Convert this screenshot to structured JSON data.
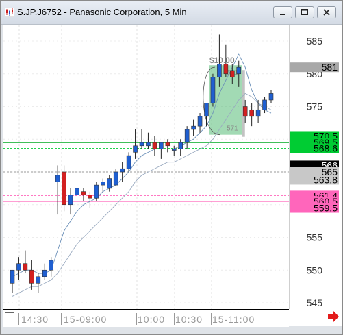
{
  "window": {
    "title": "S.JP.J6752 - Panasonic Corporation, 5 Min"
  },
  "icons": {
    "app": "chart-icon",
    "minimize": "minimize-icon",
    "maximize": "maximize-icon",
    "close": "close-icon",
    "scroll": "arrow-right-icon"
  },
  "colors": {
    "up_candle": "#1f5fd1",
    "down_candle": "#d22020",
    "green_band": "#00cc33",
    "pink_band": "#ff66bb",
    "gray_line": "#9a9a9a",
    "highlight": "#55bb77"
  },
  "time_axis": {
    "labels": [
      "14:30",
      "15-09:00",
      "10:00",
      "10:30",
      "15-11:00"
    ]
  },
  "price_axis": {
    "ticks": [
      "585",
      "580",
      "575",
      "570",
      "565",
      "560",
      "555",
      "550",
      "545"
    ],
    "tags": [
      {
        "text": "581",
        "bg": "#a8a8a8",
        "fg": "#000000"
      },
      {
        "text": "570.5",
        "bg": "#00cc33",
        "fg": "#000000"
      },
      {
        "text": "569.5",
        "bg": "#00cc33",
        "fg": "#000000"
      },
      {
        "text": "568.6",
        "bg": "#00cc33",
        "fg": "#000000"
      },
      {
        "text": "566",
        "bg": "#000000",
        "fg": "#ffffff"
      },
      {
        "text": "565",
        "bg": "#c8c8c8",
        "fg": "#000000"
      },
      {
        "text": "563.8",
        "bg": "#c8c8c8",
        "fg": "#000000"
      },
      {
        "text": "561.4",
        "bg": "#ff66bb",
        "fg": "#000000"
      },
      {
        "text": "560.5",
        "bg": "#ff66bb",
        "fg": "#000000"
      },
      {
        "text": "559.5",
        "bg": "#ff66bb",
        "fg": "#000000"
      }
    ]
  },
  "annotation": {
    "range_label": "$10.00",
    "top_value": "581",
    "bottom_value": "571"
  },
  "chart_data": {
    "type": "candlestick",
    "title": "S.JP.J6752 - Panasonic Corporation, 5 Min",
    "ylim": [
      543,
      588
    ],
    "x_labels": [
      "14:30",
      "15-09:00",
      "10:00",
      "10:30",
      "15-11:00"
    ],
    "candles": [
      {
        "o": 548,
        "h": 550,
        "l": 546.5,
        "c": 550,
        "dir": "up"
      },
      {
        "o": 550,
        "h": 552,
        "l": 548.5,
        "c": 551,
        "dir": "up"
      },
      {
        "o": 551,
        "h": 553,
        "l": 549.5,
        "c": 550,
        "dir": "down"
      },
      {
        "o": 550,
        "h": 551.5,
        "l": 547,
        "c": 548,
        "dir": "down"
      },
      {
        "o": 548,
        "h": 549.5,
        "l": 546.5,
        "c": 549,
        "dir": "up"
      },
      {
        "o": 549,
        "h": 551,
        "l": 548.5,
        "c": 550,
        "dir": "up"
      },
      {
        "o": 550,
        "h": 552,
        "l": 549,
        "c": 551.5,
        "dir": "up"
      },
      {
        "o": 564.5,
        "h": 566,
        "l": 558.5,
        "c": 563.5,
        "dir": "up"
      },
      {
        "o": 565,
        "h": 566,
        "l": 559,
        "c": 560,
        "dir": "down"
      },
      {
        "o": 560,
        "h": 562.5,
        "l": 558.5,
        "c": 561.5,
        "dir": "up"
      },
      {
        "o": 561.5,
        "h": 563,
        "l": 560.5,
        "c": 562.5,
        "dir": "up"
      },
      {
        "o": 562,
        "h": 562.5,
        "l": 560.5,
        "c": 561.5,
        "dir": "down"
      },
      {
        "o": 561.5,
        "h": 562,
        "l": 559.5,
        "c": 561,
        "dir": "down"
      },
      {
        "o": 561,
        "h": 563.5,
        "l": 560.5,
        "c": 563,
        "dir": "up"
      },
      {
        "o": 563,
        "h": 564,
        "l": 562,
        "c": 563.5,
        "dir": "up"
      },
      {
        "o": 562.5,
        "h": 564.5,
        "l": 562,
        "c": 564,
        "dir": "up"
      },
      {
        "o": 563,
        "h": 565.5,
        "l": 563,
        "c": 565,
        "dir": "up"
      },
      {
        "o": 565,
        "h": 566.5,
        "l": 563.5,
        "c": 565.5,
        "dir": "up"
      },
      {
        "o": 565.5,
        "h": 568,
        "l": 565,
        "c": 567.5,
        "dir": "up"
      },
      {
        "o": 568,
        "h": 571.5,
        "l": 567,
        "c": 569,
        "dir": "up"
      },
      {
        "o": 569,
        "h": 571.5,
        "l": 568.5,
        "c": 569.5,
        "dir": "up"
      },
      {
        "o": 569.5,
        "h": 571,
        "l": 568.5,
        "c": 569,
        "dir": "up"
      },
      {
        "o": 569.5,
        "h": 570.5,
        "l": 567.5,
        "c": 568.5,
        "dir": "down"
      },
      {
        "o": 568.5,
        "h": 569.5,
        "l": 567,
        "c": 569.5,
        "dir": "up"
      },
      {
        "o": 569.5,
        "h": 570,
        "l": 568,
        "c": 569,
        "dir": "down"
      },
      {
        "o": 568.5,
        "h": 569,
        "l": 567.5,
        "c": 568.5,
        "dir": "up"
      },
      {
        "o": 568.5,
        "h": 570,
        "l": 567.5,
        "c": 569.5,
        "dir": "up"
      },
      {
        "o": 569.5,
        "h": 572,
        "l": 568.5,
        "c": 571.5,
        "dir": "up"
      },
      {
        "o": 571.5,
        "h": 573,
        "l": 570.5,
        "c": 572,
        "dir": "up"
      },
      {
        "o": 572,
        "h": 574,
        "l": 571,
        "c": 573.5,
        "dir": "up"
      },
      {
        "o": 573.5,
        "h": 575.5,
        "l": 572,
        "c": 575.5,
        "dir": "up"
      },
      {
        "o": 575.5,
        "h": 580,
        "l": 575,
        "c": 579.5,
        "dir": "up"
      },
      {
        "o": 579.5,
        "h": 586,
        "l": 578,
        "c": 581.5,
        "dir": "up"
      },
      {
        "o": 581.5,
        "h": 584.5,
        "l": 579.5,
        "c": 580,
        "dir": "down"
      },
      {
        "o": 580.5,
        "h": 581.5,
        "l": 578.5,
        "c": 579.5,
        "dir": "down"
      },
      {
        "o": 580,
        "h": 582,
        "l": 578,
        "c": 581,
        "dir": "up"
      },
      {
        "o": 575,
        "h": 576,
        "l": 572.5,
        "c": 573.5,
        "dir": "down"
      },
      {
        "o": 574.5,
        "h": 575.5,
        "l": 572,
        "c": 573.5,
        "dir": "down"
      },
      {
        "o": 573.5,
        "h": 576,
        "l": 572.5,
        "c": 574.5,
        "dir": "up"
      },
      {
        "o": 574.5,
        "h": 576.5,
        "l": 574,
        "c": 576,
        "dir": "up"
      },
      {
        "o": 576,
        "h": 577.5,
        "l": 575.5,
        "c": 577,
        "dir": "up"
      }
    ],
    "levels": [
      {
        "value": 570.5,
        "color": "#00cc33",
        "style": "dashed"
      },
      {
        "value": 569.5,
        "color": "#00aa22",
        "style": "solid"
      },
      {
        "value": 568.6,
        "color": "#00cc33",
        "style": "dashed"
      },
      {
        "value": 565,
        "color": "#999999",
        "style": "dashed"
      },
      {
        "value": 561.4,
        "color": "#ff66bb",
        "style": "dashed"
      },
      {
        "value": 560.5,
        "color": "#ff66bb",
        "style": "solid"
      },
      {
        "value": 559.5,
        "color": "#ff66bb",
        "style": "dashed"
      }
    ],
    "moving_averages": [
      {
        "name": "",
        "values": [
          549,
          549.5,
          550,
          550,
          549.5,
          549.5,
          550,
          553,
          556,
          557.5,
          559,
          560,
          560.5,
          561,
          562,
          562.5,
          563,
          564,
          565,
          566.5,
          567.5,
          568,
          568.5,
          568.5,
          568.5,
          568.5,
          569,
          569.5,
          570,
          571,
          572,
          574,
          577,
          579,
          581,
          583,
          581,
          577.5,
          575.5,
          574.5,
          574
        ]
      },
      {
        "name": "",
        "values": [
          546,
          546.5,
          547,
          547.5,
          547.5,
          548,
          548.5,
          549.5,
          551,
          552.5,
          554,
          555,
          556,
          557,
          558,
          559,
          560,
          561,
          562,
          563.5,
          564.5,
          565,
          565.5,
          566,
          566.5,
          566.5,
          567,
          567.5,
          568,
          568.5,
          569,
          570,
          571.5,
          573,
          574.5,
          576,
          577,
          576.5,
          575.5,
          575,
          574.5
        ]
      }
    ],
    "highlight_box": {
      "x_from": 31,
      "x_to": 35,
      "y_from": 571,
      "y_to": 581
    },
    "range_annotation": {
      "label": "$10.00",
      "top": 581,
      "bottom": 571
    }
  }
}
